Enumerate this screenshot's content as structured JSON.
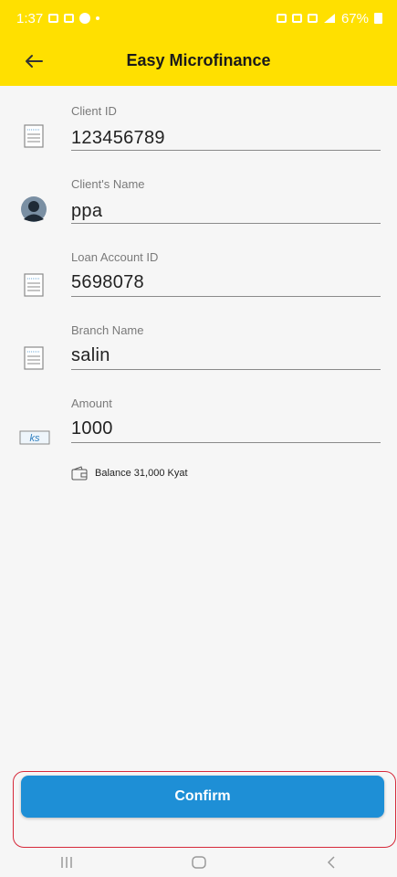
{
  "status_bar": {
    "time": "1:37",
    "battery": "67%"
  },
  "app_bar": {
    "title": "Easy Microfinance"
  },
  "form": {
    "fields": [
      {
        "label": "Client ID",
        "value": "123456789",
        "icon": "list-icon"
      },
      {
        "label": "Client's Name",
        "value": "ppa",
        "icon": "avatar-icon"
      },
      {
        "label": "Loan Account ID",
        "value": "5698078",
        "icon": "list-icon"
      },
      {
        "label": "Branch Name",
        "value": "salin",
        "icon": "list-icon"
      },
      {
        "label": "Amount",
        "value": "1000",
        "icon": "ks-currency-icon"
      }
    ],
    "currency_icon_text": "ks"
  },
  "balance": {
    "text": "Balance 31,000 Kyat",
    "icon": "wallet-icon"
  },
  "actions": {
    "confirm_label": "Confirm"
  },
  "colors": {
    "accent_yellow": "#ffe000",
    "button_blue": "#1e8fd6",
    "highlight_red": "#d6293a"
  }
}
